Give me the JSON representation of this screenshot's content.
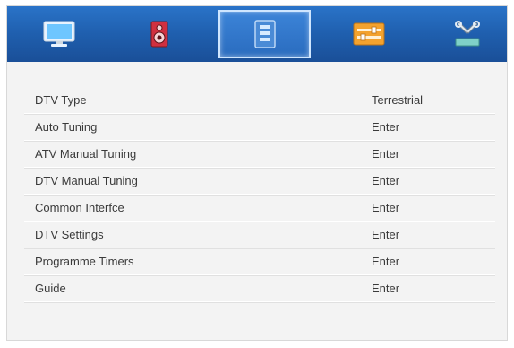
{
  "tabs": [
    {
      "icon": "monitor-icon"
    },
    {
      "icon": "speaker-icon"
    },
    {
      "icon": "channel-list-icon"
    },
    {
      "icon": "settings-sliders-icon"
    },
    {
      "icon": "tools-icon"
    }
  ],
  "selected_tab": 2,
  "menu": {
    "items": [
      {
        "label": "DTV Type",
        "value": "Terrestrial"
      },
      {
        "label": "Auto Tuning",
        "value": "Enter"
      },
      {
        "label": "ATV Manual Tuning",
        "value": "Enter"
      },
      {
        "label": "DTV Manual Tuning",
        "value": "Enter"
      },
      {
        "label": "Common Interfce",
        "value": "Enter"
      },
      {
        "label": "DTV Settings",
        "value": "Enter"
      },
      {
        "label": "Programme Timers",
        "value": "Enter"
      },
      {
        "label": "Guide",
        "value": "Enter"
      }
    ]
  },
  "colors": {
    "topbar": "#1f5fae",
    "panel": "#f3f3f3",
    "text": "#3a3a3a"
  }
}
